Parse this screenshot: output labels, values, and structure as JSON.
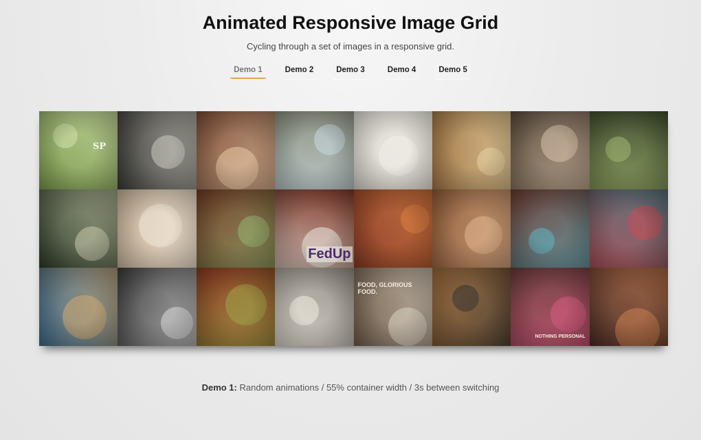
{
  "header": {
    "title": "Animated Responsive Image Grid",
    "subtitle": "Cycling through a set of images in a responsive grid."
  },
  "nav": {
    "demos": [
      "Demo 1",
      "Demo 2",
      "Demo 3",
      "Demo 4",
      "Demo 5"
    ],
    "active_index": 0,
    "accent_color": "#e8a24e"
  },
  "grid": {
    "columns": 8,
    "rows": 3,
    "tiles": [
      {
        "name": "leaf-waterdrops",
        "bg": "#7a9a4a",
        "accent": "#cfe0a8",
        "overlay_text": "SP"
      },
      {
        "name": "road-shoes",
        "bg": "#3a3a36",
        "accent": "#c9c6bb",
        "overlay_text": ""
      },
      {
        "name": "two-boys",
        "bg": "#7b4a32",
        "accent": "#e7c6a3",
        "overlay_text": ""
      },
      {
        "name": "jumping-feet",
        "bg": "#8a8f7e",
        "accent": "#c7d8e0",
        "overlay_text": ""
      },
      {
        "name": "girl-room",
        "bg": "#d9d6cc",
        "accent": "#f1efe6",
        "overlay_text": ""
      },
      {
        "name": "bread-rolls",
        "bg": "#a27745",
        "accent": "#e8d2a0",
        "overlay_text": ""
      },
      {
        "name": "lens-hand",
        "bg": "#5a4a3a",
        "accent": "#d7c0a6",
        "overlay_text": ""
      },
      {
        "name": "lily-pads",
        "bg": "#3e4a2a",
        "accent": "#9db269",
        "overlay_text": ""
      },
      {
        "name": "wild-flowers",
        "bg": "#2d3a26",
        "accent": "#c6c9a9",
        "overlay_text": ""
      },
      {
        "name": "toddler",
        "bg": "#c9b39a",
        "accent": "#f1e6d6",
        "overlay_text": ""
      },
      {
        "name": "hand-leaf",
        "bg": "#6f3a22",
        "accent": "#8fb06a",
        "overlay_text": ""
      },
      {
        "name": "fedup-man",
        "bg": "#7a3424",
        "accent": "#e9e5df",
        "overlay_text": "FedUp"
      },
      {
        "name": "red-grass",
        "bg": "#8a3a22",
        "accent": "#d97a3a",
        "overlay_text": ""
      },
      {
        "name": "man-umbrella",
        "bg": "#8f5a36",
        "accent": "#e0b28a",
        "overlay_text": ""
      },
      {
        "name": "toothbrushes",
        "bg": "#6a3a30",
        "accent": "#5ab1c0",
        "overlay_text": ""
      },
      {
        "name": "red-sneakers",
        "bg": "#4f6a74",
        "accent": "#c9434a",
        "overlay_text": ""
      },
      {
        "name": "coast-cliffs",
        "bg": "#3f6a8a",
        "accent": "#cfa56a",
        "overlay_text": ""
      },
      {
        "name": "cafe-counter",
        "bg": "#3a3a3a",
        "accent": "#d8d8d8",
        "overlay_text": ""
      },
      {
        "name": "hanging-shoes",
        "bg": "#8a3a1e",
        "accent": "#9aa040",
        "overlay_text": ""
      },
      {
        "name": "sneaker-closeup",
        "bg": "#8f8a80",
        "accent": "#f0ece2",
        "overlay_text": ""
      },
      {
        "name": "vinyl-record",
        "bg": "#6e5a48",
        "accent": "#d8cfc0",
        "overlay_text": "FOOD, GLORIOUS FOOD."
      },
      {
        "name": "twin-lens-camera",
        "bg": "#9a6a3a",
        "accent": "#2e2a26",
        "overlay_text": ""
      },
      {
        "name": "cd-headphones",
        "bg": "#6a3a3a",
        "accent": "#d6547a",
        "overlay_text": "NOTHING PERSONAL"
      },
      {
        "name": "city-sunset",
        "bg": "#4a2a22",
        "accent": "#c67a4a",
        "overlay_text": ""
      }
    ]
  },
  "footer": {
    "label": "Demo 1:",
    "text": " Random animations / 55% container width / 3s between switching"
  }
}
